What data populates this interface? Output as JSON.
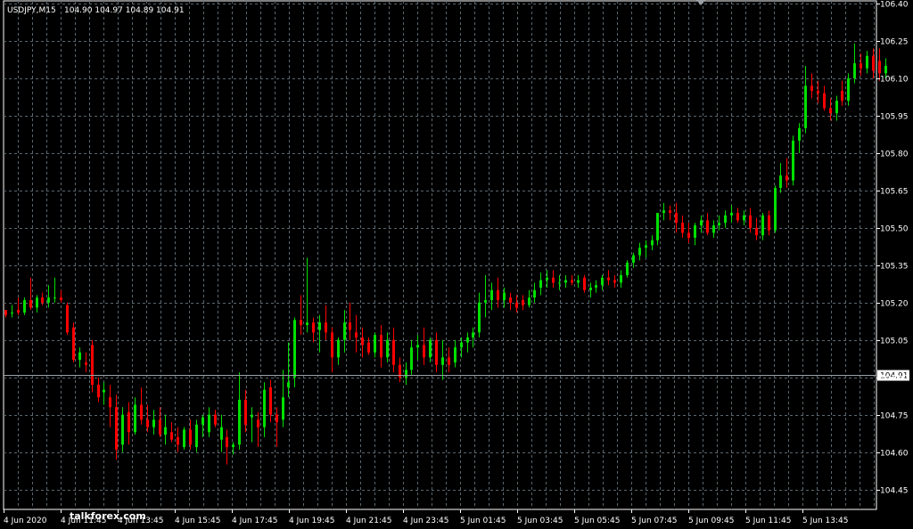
{
  "header": {
    "symbol": "USDJPY,M15",
    "ohlc": "104.90 104.97 104.89 104.91"
  },
  "watermark": "talkforex.com",
  "colors": {
    "background": "#000000",
    "grid": "#5a6770",
    "bull": "#00e000",
    "bear": "#ff0000",
    "text": "#ffffff",
    "bid_line": "#9aa0a6"
  },
  "current_price_label": "104.91",
  "chart_data": {
    "type": "candlestick",
    "symbol": "USDJPY",
    "timeframe": "M15",
    "ylim": [
      104.37,
      106.4
    ],
    "y_ticks": [
      "106.40",
      "106.25",
      "106.10",
      "105.95",
      "105.80",
      "105.65",
      "105.50",
      "105.35",
      "105.20",
      "105.05",
      "104.90",
      "104.75",
      "104.60",
      "104.45"
    ],
    "x_ticks": [
      "4 Jun 2020",
      "4 Jun 11:45",
      "4 Jun 13:45",
      "4 Jun 15:45",
      "4 Jun 17:45",
      "4 Jun 19:45",
      "4 Jun 21:45",
      "4 Jun 23:45",
      "5 Jun 01:45",
      "5 Jun 03:45",
      "5 Jun 05:45",
      "5 Jun 07:45",
      "5 Jun 09:45",
      "5 Jun 11:45",
      "5 Jun 13:45"
    ],
    "current_price": 104.91,
    "grid": true,
    "candles": [
      [
        105.17,
        105.17,
        105.14,
        105.15
      ],
      [
        105.16,
        105.19,
        105.14,
        105.16
      ],
      [
        105.17,
        105.22,
        105.15,
        105.16
      ],
      [
        105.16,
        105.22,
        105.15,
        105.21
      ],
      [
        105.21,
        105.3,
        105.17,
        105.18
      ],
      [
        105.18,
        105.23,
        105.16,
        105.22
      ],
      [
        105.22,
        105.24,
        105.19,
        105.2
      ],
      [
        105.2,
        105.27,
        105.18,
        105.22
      ],
      [
        105.22,
        105.3,
        105.2,
        105.22
      ],
      [
        105.22,
        105.25,
        105.2,
        105.21
      ],
      [
        105.19,
        105.2,
        105.07,
        105.08
      ],
      [
        105.1,
        105.12,
        104.96,
        104.97
      ],
      [
        104.97,
        105.02,
        104.94,
        105.0
      ],
      [
        104.96,
        105.0,
        104.92,
        104.95
      ],
      [
        105.03,
        105.05,
        104.84,
        104.87
      ],
      [
        104.87,
        104.9,
        104.8,
        104.82
      ],
      [
        104.84,
        104.88,
        104.79,
        104.85
      ],
      [
        104.82,
        104.87,
        104.7,
        104.78
      ],
      [
        104.78,
        104.83,
        104.57,
        104.61
      ],
      [
        104.63,
        104.78,
        104.6,
        104.75
      ],
      [
        104.76,
        104.8,
        104.63,
        104.68
      ],
      [
        104.68,
        104.82,
        104.67,
        104.79
      ],
      [
        104.79,
        104.86,
        104.71,
        104.73
      ],
      [
        104.73,
        104.79,
        104.68,
        104.7
      ],
      [
        104.7,
        104.77,
        104.67,
        104.73
      ],
      [
        104.73,
        104.78,
        104.66,
        104.67
      ],
      [
        104.67,
        104.75,
        104.63,
        104.7
      ],
      [
        104.68,
        104.72,
        104.64,
        104.65
      ],
      [
        104.66,
        104.7,
        104.6,
        104.63
      ],
      [
        104.62,
        104.7,
        104.61,
        104.69
      ],
      [
        104.69,
        104.73,
        104.61,
        104.63
      ],
      [
        104.62,
        104.73,
        104.6,
        104.71
      ],
      [
        104.71,
        104.75,
        104.66,
        104.74
      ],
      [
        104.68,
        104.78,
        104.66,
        104.75
      ],
      [
        104.75,
        104.77,
        104.7,
        104.71
      ],
      [
        104.65,
        104.75,
        104.6,
        104.7
      ],
      [
        104.66,
        104.69,
        104.55,
        104.62
      ],
      [
        104.62,
        104.64,
        104.59,
        104.63
      ],
      [
        104.63,
        104.92,
        104.61,
        104.81
      ],
      [
        104.81,
        104.85,
        104.68,
        104.71
      ],
      [
        104.74,
        104.78,
        104.64,
        104.75
      ],
      [
        104.73,
        104.76,
        104.62,
        104.7
      ],
      [
        104.7,
        104.88,
        104.66,
        104.85
      ],
      [
        104.86,
        104.89,
        104.72,
        104.75
      ],
      [
        104.75,
        104.78,
        104.62,
        104.72
      ],
      [
        104.73,
        104.93,
        104.7,
        104.82
      ],
      [
        104.86,
        105.04,
        104.82,
        104.88
      ],
      [
        104.9,
        105.14,
        104.86,
        105.13
      ],
      [
        105.13,
        105.23,
        105.07,
        105.11
      ],
      [
        105.11,
        105.38,
        105.08,
        105.12
      ],
      [
        105.12,
        105.14,
        105.04,
        105.08
      ],
      [
        105.09,
        105.15,
        105.0,
        105.12
      ],
      [
        105.12,
        105.19,
        105.05,
        105.08
      ],
      [
        105.08,
        105.1,
        104.92,
        104.98
      ],
      [
        104.98,
        105.06,
        104.95,
        105.05
      ],
      [
        105.05,
        105.17,
        105.0,
        105.12
      ],
      [
        105.12,
        105.2,
        105.05,
        105.09
      ],
      [
        105.08,
        105.15,
        105.0,
        105.06
      ],
      [
        105.06,
        105.1,
        104.98,
        105.03
      ],
      [
        105.04,
        105.06,
        104.99,
        105.0
      ],
      [
        105.0,
        105.08,
        104.98,
        105.07
      ],
      [
        105.07,
        105.11,
        104.94,
        104.98
      ],
      [
        104.98,
        105.08,
        104.96,
        105.05
      ],
      [
        105.05,
        105.1,
        104.92,
        104.95
      ],
      [
        104.95,
        104.98,
        104.88,
        104.9
      ],
      [
        104.9,
        104.96,
        104.87,
        104.93
      ],
      [
        104.93,
        105.05,
        104.91,
        105.02
      ],
      [
        105.02,
        105.07,
        104.97,
        105.03
      ],
      [
        105.03,
        105.1,
        104.95,
        104.98
      ],
      [
        104.98,
        105.06,
        104.96,
        105.05
      ],
      [
        105.05,
        105.08,
        104.92,
        104.95
      ],
      [
        104.95,
        105.05,
        104.89,
        104.98
      ],
      [
        104.98,
        105.02,
        104.92,
        104.95
      ],
      [
        104.96,
        105.05,
        104.94,
        105.02
      ],
      [
        105.02,
        105.06,
        104.98,
        105.04
      ],
      [
        105.04,
        105.08,
        105.0,
        105.06
      ],
      [
        105.06,
        105.1,
        105.02,
        105.08
      ],
      [
        105.08,
        105.24,
        105.06,
        105.2
      ],
      [
        105.2,
        105.31,
        105.14,
        105.21
      ],
      [
        105.21,
        105.28,
        105.17,
        105.25
      ],
      [
        105.25,
        105.3,
        105.18,
        105.21
      ],
      [
        105.21,
        105.26,
        105.18,
        105.24
      ],
      [
        105.22,
        105.24,
        105.17,
        105.2
      ],
      [
        105.2,
        105.23,
        105.16,
        105.18
      ],
      [
        105.21,
        105.23,
        105.17,
        105.19
      ],
      [
        105.19,
        105.25,
        105.18,
        105.22
      ],
      [
        105.22,
        105.28,
        105.2,
        105.25
      ],
      [
        105.26,
        105.32,
        105.23,
        105.29
      ],
      [
        105.29,
        105.33,
        105.26,
        105.3
      ],
      [
        105.3,
        105.33,
        105.26,
        105.28
      ],
      [
        105.28,
        105.31,
        105.25,
        105.28
      ],
      [
        105.28,
        105.31,
        105.26,
        105.29
      ],
      [
        105.29,
        105.31,
        105.27,
        105.28
      ],
      [
        105.28,
        105.31,
        105.26,
        105.29
      ],
      [
        105.3,
        105.31,
        105.24,
        105.25
      ],
      [
        105.25,
        105.28,
        105.22,
        105.26
      ],
      [
        105.26,
        105.29,
        105.24,
        105.27
      ],
      [
        105.27,
        105.31,
        105.25,
        105.3
      ],
      [
        105.3,
        105.33,
        105.27,
        105.29
      ],
      [
        105.29,
        105.31,
        105.26,
        105.28
      ],
      [
        105.28,
        105.33,
        105.26,
        105.31
      ],
      [
        105.31,
        105.37,
        105.3,
        105.36
      ],
      [
        105.36,
        105.4,
        105.34,
        105.39
      ],
      [
        105.39,
        105.44,
        105.37,
        105.42
      ],
      [
        105.42,
        105.45,
        105.38,
        105.43
      ],
      [
        105.43,
        105.47,
        105.41,
        105.45
      ],
      [
        105.45,
        105.55,
        105.43,
        105.56
      ],
      [
        105.56,
        105.6,
        105.53,
        105.57
      ],
      [
        105.57,
        105.59,
        105.53,
        105.56
      ],
      [
        105.56,
        105.6,
        105.48,
        105.52
      ],
      [
        105.52,
        105.55,
        105.46,
        105.48
      ],
      [
        105.48,
        105.52,
        105.44,
        105.46
      ],
      [
        105.46,
        105.52,
        105.43,
        105.51
      ],
      [
        105.51,
        105.55,
        105.48,
        105.53
      ],
      [
        105.53,
        105.56,
        105.47,
        105.48
      ],
      [
        105.48,
        105.53,
        105.46,
        105.51
      ],
      [
        105.51,
        105.55,
        105.49,
        105.52
      ],
      [
        105.52,
        105.57,
        105.5,
        105.55
      ],
      [
        105.55,
        105.59,
        105.52,
        105.56
      ],
      [
        105.56,
        105.58,
        105.52,
        105.53
      ],
      [
        105.53,
        105.57,
        105.51,
        105.55
      ],
      [
        105.55,
        105.58,
        105.48,
        105.5
      ],
      [
        105.5,
        105.54,
        105.45,
        105.47
      ],
      [
        105.47,
        105.56,
        105.45,
        105.55
      ],
      [
        105.55,
        105.57,
        105.47,
        105.49
      ],
      [
        105.49,
        105.67,
        105.48,
        105.66
      ],
      [
        105.66,
        105.76,
        105.64,
        105.71
      ],
      [
        105.71,
        105.78,
        105.66,
        105.69
      ],
      [
        105.69,
        105.87,
        105.67,
        105.85
      ],
      [
        105.85,
        105.92,
        105.8,
        105.9
      ],
      [
        105.9,
        106.15,
        105.88,
        106.07
      ],
      [
        106.07,
        106.12,
        106.02,
        106.05
      ],
      [
        106.05,
        106.09,
        106.0,
        106.04
      ],
      [
        106.04,
        106.07,
        105.97,
        105.98
      ],
      [
        105.98,
        106.02,
        105.93,
        105.96
      ],
      [
        105.96,
        106.03,
        105.93,
        106.01
      ],
      [
        106.05,
        106.09,
        105.99,
        106.01
      ],
      [
        106.01,
        106.12,
        105.99,
        106.1
      ],
      [
        106.1,
        106.24,
        106.08,
        106.16
      ],
      [
        106.16,
        106.2,
        106.11,
        106.14
      ],
      [
        106.14,
        106.21,
        106.12,
        106.19
      ],
      [
        106.19,
        106.22,
        106.1,
        106.13
      ],
      [
        106.17,
        106.22,
        106.09,
        106.12
      ],
      [
        106.12,
        106.18,
        106.1,
        106.15
      ]
    ]
  }
}
